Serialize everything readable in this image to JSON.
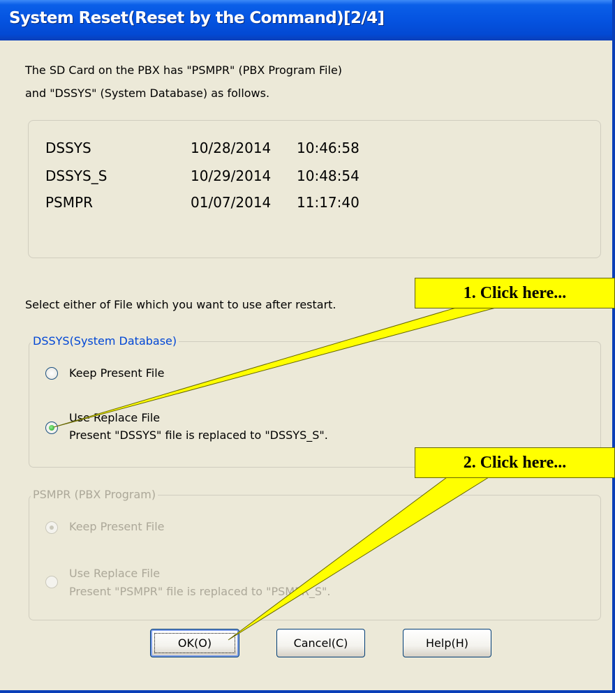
{
  "window": {
    "title": "System Reset(Reset by the Command)[2/4]"
  },
  "intro": {
    "line1": "The SD Card on the PBX has \"PSMPR\" (PBX Program File)",
    "line2": "and  \"DSSYS\" (System Database) as follows."
  },
  "files": [
    {
      "name": "DSSYS",
      "date": "10/28/2014",
      "time": "10:46:58"
    },
    {
      "name": "DSSYS_S",
      "date": "10/29/2014",
      "time": "10:48:54"
    },
    {
      "name": "PSMPR",
      "date": "01/07/2014",
      "time": "11:17:40"
    }
  ],
  "select_prompt": "Select either of File which you want to use after restart.",
  "dssys_group": {
    "label": "DSSYS(System Database)",
    "keep_label": "Keep Present File",
    "replace_label": "Use Replace File",
    "replace_desc": "Present \"DSSYS\" file is replaced to \"DSSYS_S\".",
    "selected": "replace"
  },
  "psmpr_group": {
    "label": "PSMPR (PBX Program)",
    "keep_label": "Keep Present File",
    "replace_label": "Use Replace File",
    "replace_desc": "Present \"PSMPR\" file is replaced to \"PSMPR_S\".",
    "selected": "keep",
    "disabled": true
  },
  "buttons": {
    "ok": "OK(O)",
    "cancel": "Cancel(C)",
    "help": "Help(H)"
  },
  "callouts": {
    "one": "1. Click here...",
    "two": "2. Click here..."
  },
  "colors": {
    "title_bar": "#0553e0",
    "window_bg": "#ece9d8",
    "group_label": "#0046d5",
    "callout_bg": "#ffff00",
    "disabled_text": "#aca899"
  }
}
